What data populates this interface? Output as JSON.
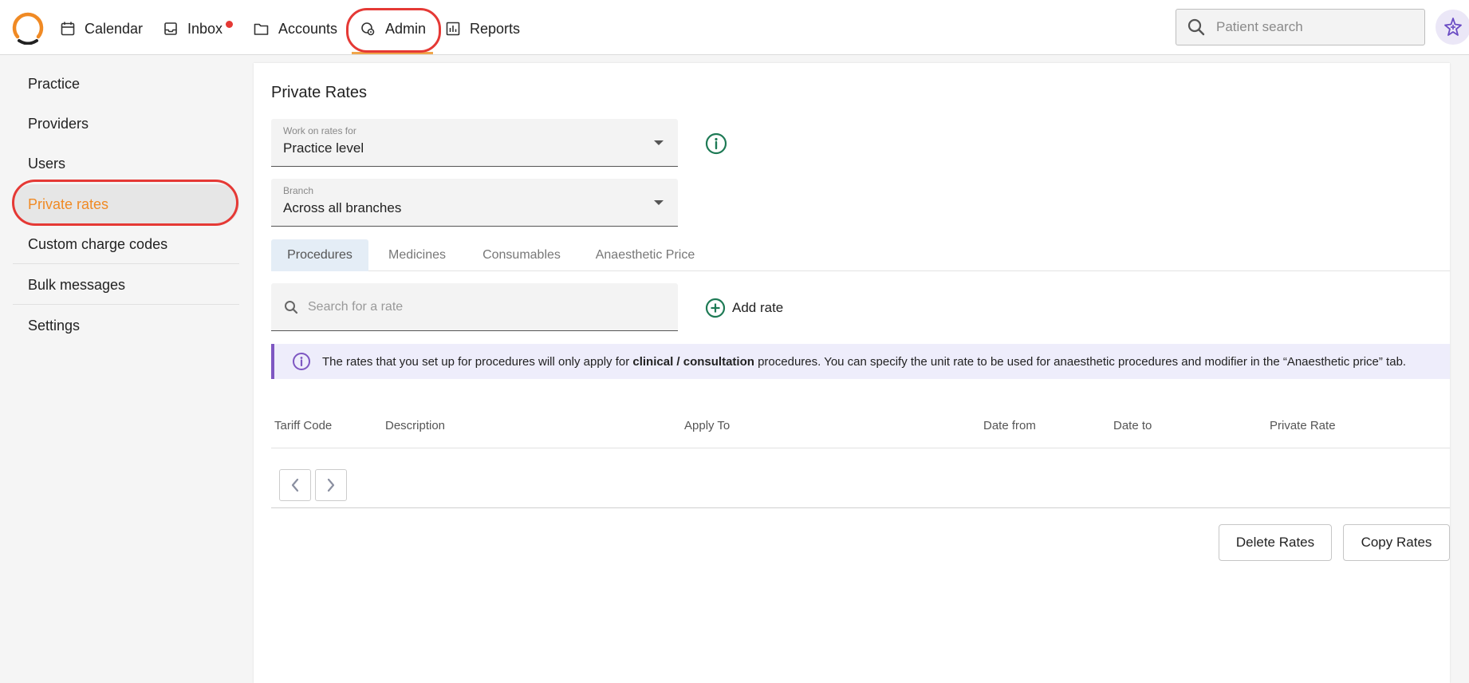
{
  "nav": {
    "calendar": "Calendar",
    "inbox": "Inbox",
    "accounts": "Accounts",
    "admin": "Admin",
    "reports": "Reports"
  },
  "search": {
    "placeholder": "Patient search"
  },
  "sidebar": {
    "items": [
      {
        "label": "Practice"
      },
      {
        "label": "Providers"
      },
      {
        "label": "Users"
      },
      {
        "label": "Private rates"
      },
      {
        "label": "Custom charge codes"
      },
      {
        "label": "Bulk messages"
      },
      {
        "label": "Settings"
      }
    ]
  },
  "main": {
    "title": "Private Rates",
    "work_on": {
      "label": "Work on rates for",
      "value": "Practice level"
    },
    "branch": {
      "label": "Branch",
      "value": "Across all branches"
    },
    "tabs": [
      {
        "label": "Procedures"
      },
      {
        "label": "Medicines"
      },
      {
        "label": "Consumables"
      },
      {
        "label": "Anaesthetic Price"
      }
    ],
    "rate_search_placeholder": "Search for a rate",
    "add_rate": "Add rate",
    "notice": {
      "pre": "The rates that you set up for procedures will only apply for ",
      "bold1": "clinical",
      "sep": " / ",
      "bold2": "consultation",
      "post": " procedures. You can specify the unit rate to be used for anaesthetic procedures and modifier in the “Anaesthetic price” tab."
    },
    "columns": [
      "Tariff Code",
      "Description",
      "Apply To",
      "Date from",
      "Date to",
      "Private Rate"
    ],
    "delete_rates": "Delete Rates",
    "copy_rates": "Copy Rates"
  },
  "colors": {
    "accent_orange": "#f08a24",
    "highlight_red": "#e53935",
    "green": "#1e7a55",
    "purple": "#7e57c2"
  }
}
